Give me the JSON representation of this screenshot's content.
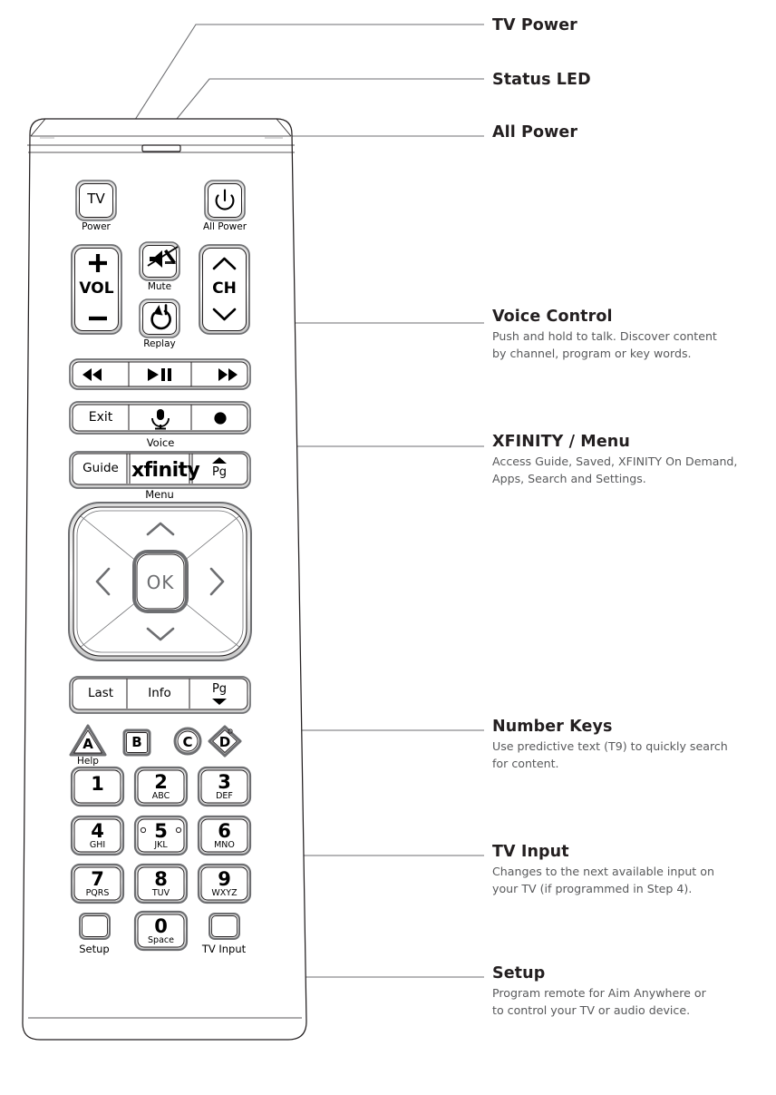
{
  "document": {
    "kind": "remote-control-diagram",
    "device": "XFINITY XR11 voice remote",
    "line_color": "#6d6e71",
    "ink_color": "#231f20",
    "body_color": "#ffffff",
    "text_color": "#58595b"
  },
  "callouts": [
    {
      "id": "tv-power",
      "title": "TV Power",
      "body": []
    },
    {
      "id": "status-led",
      "title": "Status LED",
      "body": []
    },
    {
      "id": "all-power",
      "title": "All Power",
      "body": []
    },
    {
      "id": "voice-control",
      "title": "Voice Control",
      "body": [
        "Push and hold to talk. Discover content",
        "by channel, program or key words."
      ]
    },
    {
      "id": "xfinity-menu",
      "title": "XFINITY / Menu",
      "body": [
        "Access Guide, Saved, XFINITY On Demand,",
        "Apps, Search and Settings."
      ]
    },
    {
      "id": "number-keys",
      "title": "Number Keys",
      "body": [
        "Use predictive text (T9) to quickly search",
        "for content."
      ]
    },
    {
      "id": "tv-input",
      "title": "TV Input",
      "body": [
        "Changes to the next available input on",
        "your TV (if programmed in Step 4)."
      ]
    },
    {
      "id": "setup",
      "title": "Setup",
      "body": [
        "Program remote for Aim Anywhere or",
        "to control your TV or audio device."
      ]
    }
  ],
  "remote": {
    "buttons": {
      "tv_power": {
        "label": "TV",
        "caption": "Power"
      },
      "all_power": {
        "label": "power-icon",
        "caption": "All Power"
      },
      "volume": {
        "label": "VOL",
        "plus": "+",
        "minus": "−"
      },
      "mute": {
        "label": "mute-icon",
        "caption": "Mute"
      },
      "replay": {
        "label": "replay-icon",
        "caption": "Replay"
      },
      "channel": {
        "label": "CH",
        "up": "chevron-up-icon",
        "down": "chevron-down-icon"
      },
      "rewind": {
        "label": "rewind-icon"
      },
      "play_pause": {
        "label": "play-pause-icon"
      },
      "fast_forward": {
        "label": "fast-forward-icon"
      },
      "exit": {
        "label": "Exit"
      },
      "voice": {
        "label": "microphone-icon",
        "caption": "Voice"
      },
      "record": {
        "label": "record-icon"
      },
      "guide": {
        "label": "Guide"
      },
      "xfinity": {
        "label": "xfinity",
        "caption": "Menu"
      },
      "page_up": {
        "label": "Pg",
        "icon": "triangle-up-icon"
      },
      "dpad": {
        "ok": "OK",
        "up": "chevron-up-icon",
        "down": "chevron-down-icon",
        "left": "chevron-left-icon",
        "right": "chevron-right-icon"
      },
      "last": {
        "label": "Last"
      },
      "info": {
        "label": "Info"
      },
      "page_down": {
        "label": "Pg",
        "icon": "triangle-down-icon"
      },
      "a": {
        "label": "A",
        "caption": "Help",
        "shape": "triangle"
      },
      "b": {
        "label": "B",
        "shape": "square"
      },
      "c": {
        "label": "C",
        "shape": "circle"
      },
      "d": {
        "label": "D",
        "shape": "diamond"
      },
      "setup": {
        "caption": "Setup"
      },
      "tv_input": {
        "caption": "TV Input"
      }
    },
    "keypad": [
      {
        "digit": "1",
        "letters": ""
      },
      {
        "digit": "2",
        "letters": "ABC"
      },
      {
        "digit": "3",
        "letters": "DEF"
      },
      {
        "digit": "4",
        "letters": "GHI"
      },
      {
        "digit": "5",
        "letters": "JKL"
      },
      {
        "digit": "6",
        "letters": "MNO"
      },
      {
        "digit": "7",
        "letters": "PQRS"
      },
      {
        "digit": "8",
        "letters": "TUV"
      },
      {
        "digit": "9",
        "letters": "WXYZ"
      },
      {
        "digit": "0",
        "letters": "Space"
      }
    ]
  }
}
